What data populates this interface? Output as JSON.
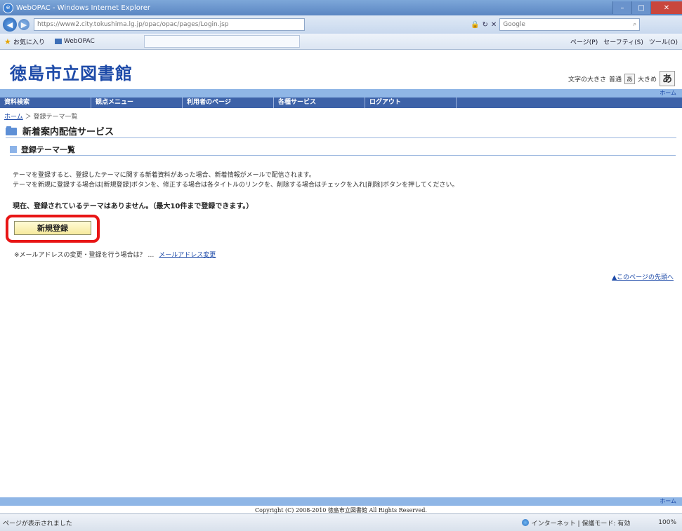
{
  "window": {
    "title": "WebOPAC - Windows Internet Explorer",
    "min": "–",
    "max": "□",
    "close": "✕"
  },
  "browser": {
    "url": "https://www2.city.tokushima.lg.jp/opac/opac/pages/Login.jsp",
    "search_placeholder": "Google",
    "favorites_label": "お気に入り",
    "tab_label": "WebOPAC",
    "commands": [
      "ページ(P)",
      "セーフティ(S)",
      "ツール(O)"
    ]
  },
  "header": {
    "library_name": "徳島市立図書館",
    "font_size_label": "文字の大きさ",
    "font_normal": "普通",
    "font_large": "大きめ",
    "font_large_glyph": "あ",
    "font_small_glyph": "あ",
    "home_link": "ホーム"
  },
  "nav": {
    "items": [
      "資料検索",
      "観点メニュー",
      "利用者のページ",
      "各種サービス",
      "ログアウト"
    ]
  },
  "breadcrumb": {
    "home": "ホーム",
    "current": "登録テーマ一覧"
  },
  "main": {
    "service_title": "新着案内配信サービス",
    "section_title": "登録テーマ一覧",
    "desc1": "テーマを登録すると、登録したテーマに関する新着資料があった場合、新着情報がメールで配信されます。",
    "desc2": "テーマを新規に登録する場合は[新規登録]ボタンを、修正する場合は各タイトルのリンクを、削除する場合はチェックを入れ[削除]ボタンを押してください。",
    "status": "現在、登録されているテーマはありません。（最大10件まで登録できます。）",
    "register_button": "新規登録",
    "mail_question": "※メールアドレスの変更・登録を行う場合は？ …",
    "mail_link": "メールアドレス変更",
    "page_top": "▲このページの先頭へ"
  },
  "footer": {
    "home_link": "ホーム",
    "copyright": "Copyright (C) 2008-2010 徳島市立図書館 All Rights Reserved."
  },
  "statusbar": {
    "left": "ページが表示されました",
    "zone": "インターネット | 保護モード: 有効",
    "zoom": "100%"
  }
}
